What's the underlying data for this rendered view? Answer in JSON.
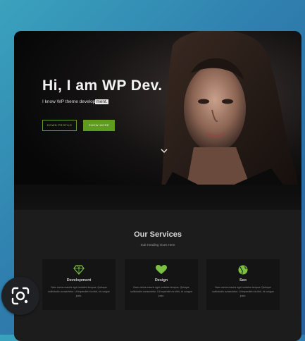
{
  "hero": {
    "title": "Hi, I am WP Dev.",
    "tagline_prefix": "I know WP theme develop",
    "tagline_selected": "ment.",
    "primary_button": "DOWN PROFILE",
    "secondary_button": "SHOW MORE"
  },
  "services": {
    "heading": "Our Services",
    "subheading": "Sub Heading Goes Here",
    "cards": [
      {
        "title": "Development",
        "icon": "diamond-icon",
        "body": "Nam varius mauris eget sodales tempus. Quisque sollicitudin consectetur. Ut imperdiet mi nibh, et congue justo."
      },
      {
        "title": "Design",
        "icon": "heart-icon",
        "body": "Nam varius mauris eget sodales tempus. Quisque sollicitudin consectetur. Ut imperdiet mi nibh, et congue justo."
      },
      {
        "title": "Seo",
        "icon": "globe-icon",
        "body": "Nam varius mauris eget sodales tempus. Quisque sollicitudin consectetur. Ut imperdiet mi nibh, et congue justo."
      }
    ]
  },
  "colors": {
    "accent": "#5e9b1e",
    "accent_light": "#7cc043",
    "background_dark": "#1c1c1c"
  },
  "overlay": {
    "lens_button_icon": "google-lens-icon"
  }
}
